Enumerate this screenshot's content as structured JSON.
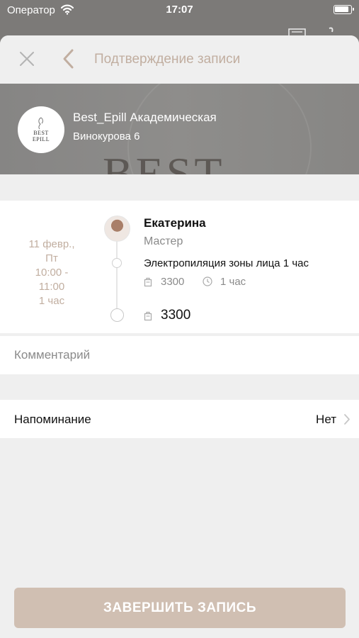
{
  "status_bar": {
    "carrier": "Оператор",
    "time": "17:07"
  },
  "nav": {
    "title": "Подтверждение записи"
  },
  "salon": {
    "name": "Best_Epill Академическая",
    "address": "Винокурова 6",
    "logo_text_top": "BEST",
    "logo_text_bottom": "EPILL",
    "banner_text": "BEST"
  },
  "appointment": {
    "date_lines": [
      "11 февр.,",
      "Пт",
      "10:00 -",
      "11:00",
      "1 час"
    ],
    "master_name": "Екатерина",
    "master_role": "Мастер",
    "service_name": "Электропиляция зоны лица 1 час",
    "service_price": "3300",
    "service_duration": "1 час",
    "total_price": "3300"
  },
  "comment": {
    "placeholder": "Комментарий"
  },
  "reminder": {
    "label": "Напоминание",
    "value": "Нет"
  },
  "actions": {
    "finish_label": "ЗАВЕРШИТЬ ЗАПИСЬ"
  },
  "colors": {
    "accent": "#c1aea0",
    "button": "#d0bfb2"
  }
}
